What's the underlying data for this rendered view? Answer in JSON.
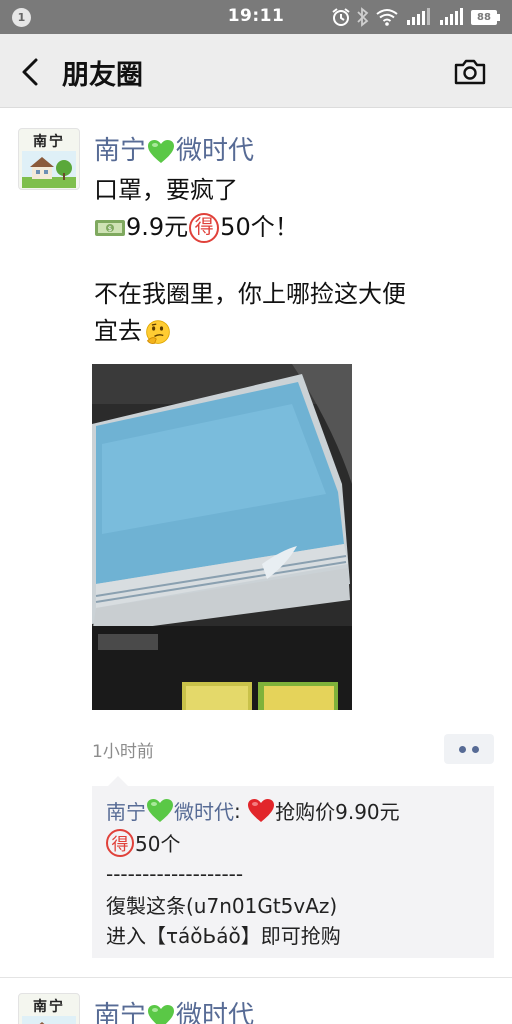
{
  "status_bar": {
    "notification_count": "1",
    "time": "19:11",
    "battery": "88"
  },
  "header": {
    "title": "朋友圈"
  },
  "posts": [
    {
      "avatar_text": "南宁",
      "author_before": "南宁",
      "author_after": "微时代",
      "text_line1": "口罩，要疯了",
      "text_line2_price": "9.9元",
      "text_line2_de": "得",
      "text_line2_rest": "50个！",
      "text_line3": "不在我圈里，你上哪捡这大便",
      "text_line4": "宜去",
      "timestamp": "1小时前",
      "comment": {
        "author_before": "南宁",
        "author_after": "微时代",
        "colon": ": ",
        "line1_rest": "抢购价9.90元",
        "line2_de": "得",
        "line2_rest": "50个",
        "line3": "-------------------",
        "line4": "復製这条(u7n01Gt5vAz)",
        "line5": "进入【τáǒЬáǒ】即可抢购"
      }
    },
    {
      "avatar_text": "南宁",
      "author_before": "南宁",
      "author_after": "微时代"
    }
  ],
  "colors": {
    "link": "#576b95",
    "heart_green": "#5ac846",
    "heart_red": "#e2262b",
    "de_red": "#e0413a"
  },
  "icons": [
    "back-arrow-icon",
    "camera-icon",
    "green-heart-icon",
    "money-icon",
    "thinking-face-icon",
    "red-heart-icon"
  ]
}
